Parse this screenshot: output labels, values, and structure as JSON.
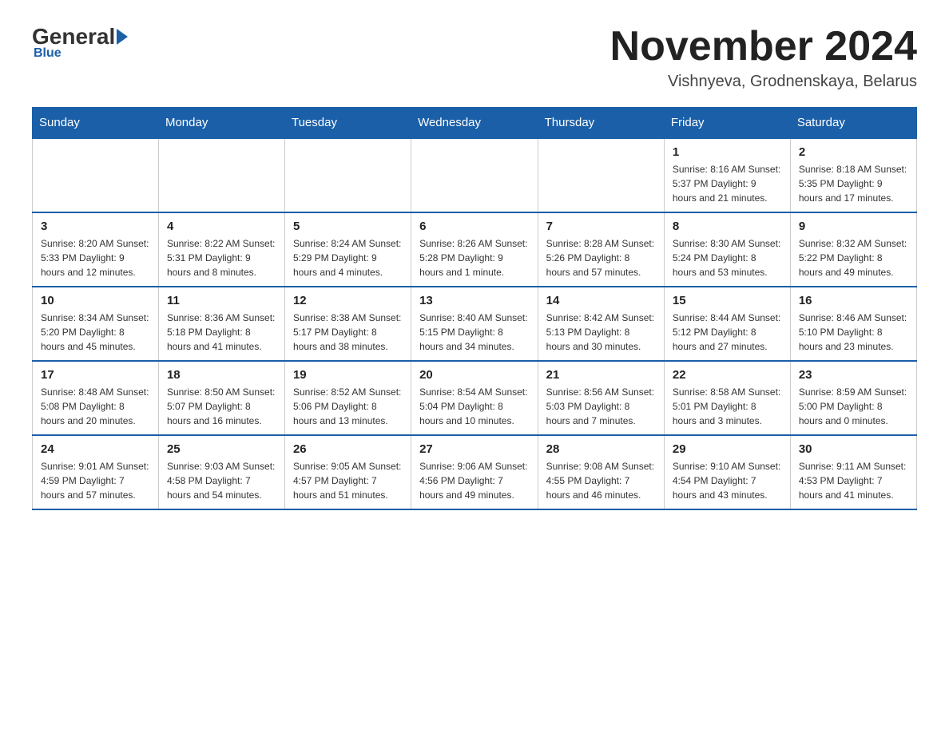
{
  "logo": {
    "general": "General",
    "blue": "Blue"
  },
  "title": "November 2024",
  "location": "Vishnyeva, Grodnenskaya, Belarus",
  "days_of_week": [
    "Sunday",
    "Monday",
    "Tuesday",
    "Wednesday",
    "Thursday",
    "Friday",
    "Saturday"
  ],
  "weeks": [
    [
      {
        "day": "",
        "info": ""
      },
      {
        "day": "",
        "info": ""
      },
      {
        "day": "",
        "info": ""
      },
      {
        "day": "",
        "info": ""
      },
      {
        "day": "",
        "info": ""
      },
      {
        "day": "1",
        "info": "Sunrise: 8:16 AM\nSunset: 5:37 PM\nDaylight: 9 hours and 21 minutes."
      },
      {
        "day": "2",
        "info": "Sunrise: 8:18 AM\nSunset: 5:35 PM\nDaylight: 9 hours and 17 minutes."
      }
    ],
    [
      {
        "day": "3",
        "info": "Sunrise: 8:20 AM\nSunset: 5:33 PM\nDaylight: 9 hours and 12 minutes."
      },
      {
        "day": "4",
        "info": "Sunrise: 8:22 AM\nSunset: 5:31 PM\nDaylight: 9 hours and 8 minutes."
      },
      {
        "day": "5",
        "info": "Sunrise: 8:24 AM\nSunset: 5:29 PM\nDaylight: 9 hours and 4 minutes."
      },
      {
        "day": "6",
        "info": "Sunrise: 8:26 AM\nSunset: 5:28 PM\nDaylight: 9 hours and 1 minute."
      },
      {
        "day": "7",
        "info": "Sunrise: 8:28 AM\nSunset: 5:26 PM\nDaylight: 8 hours and 57 minutes."
      },
      {
        "day": "8",
        "info": "Sunrise: 8:30 AM\nSunset: 5:24 PM\nDaylight: 8 hours and 53 minutes."
      },
      {
        "day": "9",
        "info": "Sunrise: 8:32 AM\nSunset: 5:22 PM\nDaylight: 8 hours and 49 minutes."
      }
    ],
    [
      {
        "day": "10",
        "info": "Sunrise: 8:34 AM\nSunset: 5:20 PM\nDaylight: 8 hours and 45 minutes."
      },
      {
        "day": "11",
        "info": "Sunrise: 8:36 AM\nSunset: 5:18 PM\nDaylight: 8 hours and 41 minutes."
      },
      {
        "day": "12",
        "info": "Sunrise: 8:38 AM\nSunset: 5:17 PM\nDaylight: 8 hours and 38 minutes."
      },
      {
        "day": "13",
        "info": "Sunrise: 8:40 AM\nSunset: 5:15 PM\nDaylight: 8 hours and 34 minutes."
      },
      {
        "day": "14",
        "info": "Sunrise: 8:42 AM\nSunset: 5:13 PM\nDaylight: 8 hours and 30 minutes."
      },
      {
        "day": "15",
        "info": "Sunrise: 8:44 AM\nSunset: 5:12 PM\nDaylight: 8 hours and 27 minutes."
      },
      {
        "day": "16",
        "info": "Sunrise: 8:46 AM\nSunset: 5:10 PM\nDaylight: 8 hours and 23 minutes."
      }
    ],
    [
      {
        "day": "17",
        "info": "Sunrise: 8:48 AM\nSunset: 5:08 PM\nDaylight: 8 hours and 20 minutes."
      },
      {
        "day": "18",
        "info": "Sunrise: 8:50 AM\nSunset: 5:07 PM\nDaylight: 8 hours and 16 minutes."
      },
      {
        "day": "19",
        "info": "Sunrise: 8:52 AM\nSunset: 5:06 PM\nDaylight: 8 hours and 13 minutes."
      },
      {
        "day": "20",
        "info": "Sunrise: 8:54 AM\nSunset: 5:04 PM\nDaylight: 8 hours and 10 minutes."
      },
      {
        "day": "21",
        "info": "Sunrise: 8:56 AM\nSunset: 5:03 PM\nDaylight: 8 hours and 7 minutes."
      },
      {
        "day": "22",
        "info": "Sunrise: 8:58 AM\nSunset: 5:01 PM\nDaylight: 8 hours and 3 minutes."
      },
      {
        "day": "23",
        "info": "Sunrise: 8:59 AM\nSunset: 5:00 PM\nDaylight: 8 hours and 0 minutes."
      }
    ],
    [
      {
        "day": "24",
        "info": "Sunrise: 9:01 AM\nSunset: 4:59 PM\nDaylight: 7 hours and 57 minutes."
      },
      {
        "day": "25",
        "info": "Sunrise: 9:03 AM\nSunset: 4:58 PM\nDaylight: 7 hours and 54 minutes."
      },
      {
        "day": "26",
        "info": "Sunrise: 9:05 AM\nSunset: 4:57 PM\nDaylight: 7 hours and 51 minutes."
      },
      {
        "day": "27",
        "info": "Sunrise: 9:06 AM\nSunset: 4:56 PM\nDaylight: 7 hours and 49 minutes."
      },
      {
        "day": "28",
        "info": "Sunrise: 9:08 AM\nSunset: 4:55 PM\nDaylight: 7 hours and 46 minutes."
      },
      {
        "day": "29",
        "info": "Sunrise: 9:10 AM\nSunset: 4:54 PM\nDaylight: 7 hours and 43 minutes."
      },
      {
        "day": "30",
        "info": "Sunrise: 9:11 AM\nSunset: 4:53 PM\nDaylight: 7 hours and 41 minutes."
      }
    ]
  ]
}
